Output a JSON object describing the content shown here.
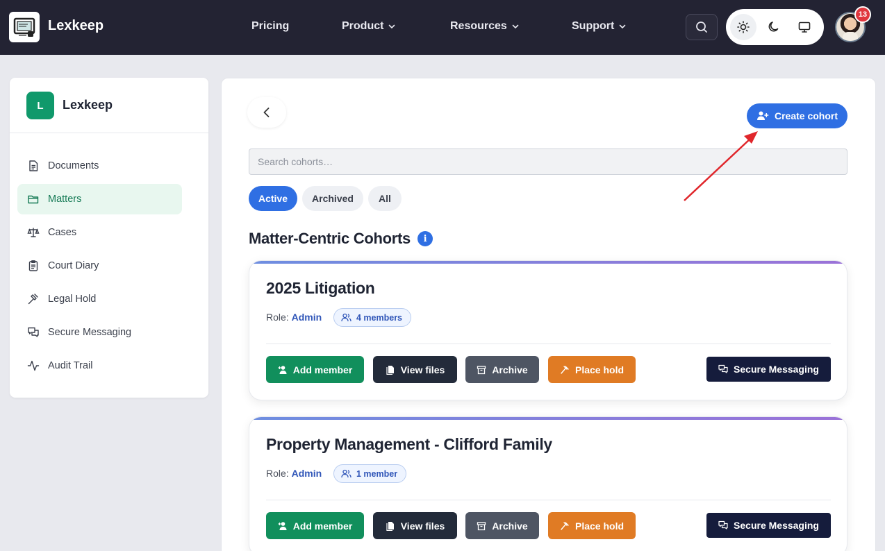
{
  "topbar": {
    "brand": "Lexkeep",
    "nav": [
      {
        "label": "Pricing",
        "has_dropdown": false
      },
      {
        "label": "Product",
        "has_dropdown": true
      },
      {
        "label": "Resources",
        "has_dropdown": true
      },
      {
        "label": "Support",
        "has_dropdown": true
      }
    ],
    "notifications_count": "13",
    "icons": [
      "logo-icon",
      "search-icon",
      "sun-icon",
      "moon-icon",
      "monitor-icon",
      "avatar"
    ]
  },
  "sidebar": {
    "badge": "L",
    "title": "Lexkeep",
    "items": [
      {
        "label": "Documents",
        "icon": "document-icon",
        "active": false
      },
      {
        "label": "Matters",
        "icon": "folder-icon",
        "active": true
      },
      {
        "label": "Cases",
        "icon": "scale-icon",
        "active": false
      },
      {
        "label": "Court Diary",
        "icon": "clipboard-icon",
        "active": false
      },
      {
        "label": "Legal Hold",
        "icon": "gavel-icon",
        "active": false
      },
      {
        "label": "Secure Messaging",
        "icon": "messages-icon",
        "active": false
      },
      {
        "label": "Audit Trail",
        "icon": "activity-icon",
        "active": false
      }
    ]
  },
  "main": {
    "create_label": "Create cohort",
    "search_placeholder": "Search cohorts…",
    "filters": [
      {
        "label": "Active",
        "active": true
      },
      {
        "label": "Archived",
        "active": false
      },
      {
        "label": "All",
        "active": false
      }
    ],
    "section_title": "Matter-Centric Cohorts",
    "role_prefix": "Role:",
    "cohorts": [
      {
        "title": "2025 Litigation",
        "role": "Admin",
        "members": "4 members"
      },
      {
        "title": "Property Management - Clifford Family",
        "role": "Admin",
        "members": "1 member"
      }
    ],
    "actions": {
      "add_member": "Add member",
      "view_files": "View files",
      "archive": "Archive",
      "place_hold": "Place hold",
      "secure_messaging": "Secure Messaging"
    }
  },
  "colors": {
    "primary": "#2f6fe3",
    "topbar": "#232333",
    "green": "#118f5c",
    "orange": "#e07b24",
    "navy": "#151c3c",
    "annotation_arrow": "#e0262b"
  }
}
